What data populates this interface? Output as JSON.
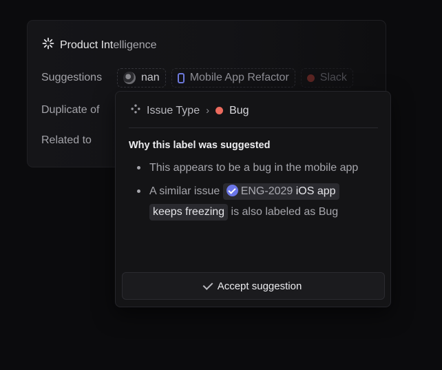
{
  "panel": {
    "title_main": "Product Int",
    "title_dim": "elligence",
    "rows": {
      "suggestions": "Suggestions",
      "duplicate": "Duplicate of",
      "related": "Related to"
    },
    "chips": [
      {
        "label": "nan",
        "icon": "globe-icon"
      },
      {
        "label": "Mobile App Refactor",
        "icon": "phone-icon"
      },
      {
        "label": "Slack",
        "icon": "red-dot-icon"
      }
    ]
  },
  "popover": {
    "crumb_type": "Issue Type",
    "crumb_separator": "›",
    "crumb_value": "Bug",
    "why_heading": "Why this label was suggested",
    "reasons": {
      "first": "This appears to be a bug in the mobile app",
      "second_prefix": "A similar issue",
      "issue_id": "ENG-2029",
      "issue_title_part1": "iOS app",
      "issue_title_part2": "keeps freezing",
      "second_suffix": "is also labeled as Bug"
    },
    "accept_label": "Accept suggestion"
  },
  "colors": {
    "background": "#0b0b0d",
    "bug_dot": "#ec6b5e",
    "accent_blue": "#6b76e8"
  }
}
